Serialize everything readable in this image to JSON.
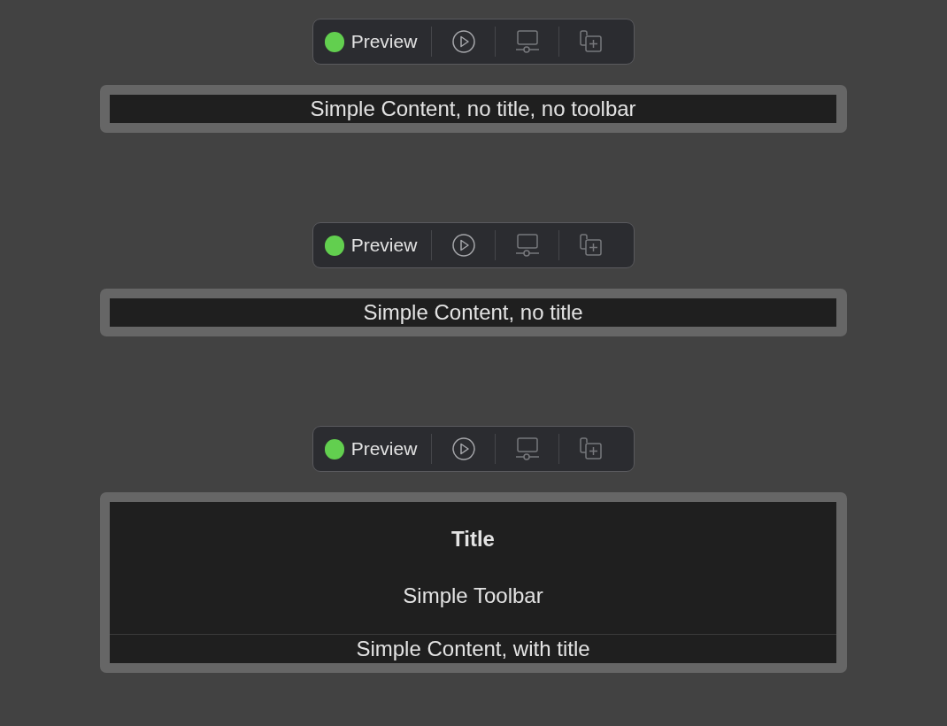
{
  "previews": [
    {
      "toolbar": {
        "status_active": true,
        "label": "Preview",
        "buttons": [
          {
            "kind": "play",
            "disabled": false
          },
          {
            "kind": "device",
            "disabled": true
          },
          {
            "kind": "duplicate",
            "disabled": true
          }
        ]
      },
      "content": "Simple Content, no title, no toolbar"
    },
    {
      "toolbar": {
        "status_active": true,
        "label": "Preview",
        "buttons": [
          {
            "kind": "play",
            "disabled": false
          },
          {
            "kind": "device",
            "disabled": true
          },
          {
            "kind": "duplicate",
            "disabled": true
          }
        ]
      },
      "content": "Simple Content, no title"
    },
    {
      "toolbar": {
        "status_active": true,
        "label": "Preview",
        "buttons": [
          {
            "kind": "play",
            "disabled": false
          },
          {
            "kind": "device",
            "disabled": true
          },
          {
            "kind": "duplicate",
            "disabled": true
          }
        ]
      },
      "title": "Title",
      "toolbar_text": "Simple Toolbar",
      "content": "Simple Content, with title"
    }
  ]
}
